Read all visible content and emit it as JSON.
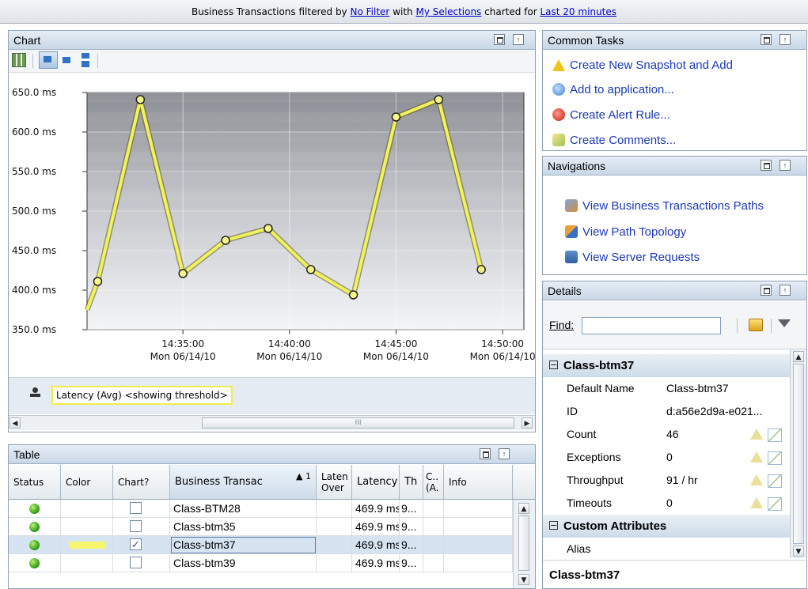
{
  "filter_bar": {
    "prefix": "Business Transactions filtered by",
    "filter_link": "No Filter",
    "with_text": "with",
    "selections_link": "My Selections",
    "charted_text": "charted for",
    "time_link": "Last 20 minutes"
  },
  "chart_panel": {
    "title": "Chart",
    "legend_label": "Latency (Avg) <showing threshold>"
  },
  "chart_data": {
    "type": "line",
    "title": "",
    "xlabel": "",
    "ylabel": "",
    "ylim": [
      350,
      650
    ],
    "y_ticks": [
      "650.0 ms",
      "600.0 ms",
      "550.0 ms",
      "500.0 ms",
      "450.0 ms",
      "400.0 ms",
      "350.0 ms"
    ],
    "y_tick_values": [
      650,
      600,
      550,
      500,
      450,
      400,
      350
    ],
    "x_ticks": [
      {
        "time": "14:35:00",
        "date": "Mon 06/14/10"
      },
      {
        "time": "14:40:00",
        "date": "Mon 06/14/10"
      },
      {
        "time": "14:45:00",
        "date": "Mon 06/14/10"
      },
      {
        "time": "14:50:00",
        "date": "Mon 06/14/10"
      }
    ],
    "series": [
      {
        "name": "Latency (Avg) <showing threshold>",
        "color": "#f2f25a",
        "x_minutes": [
          "14:30:30",
          "14:31",
          "14:33",
          "14:35",
          "14:37",
          "14:39",
          "14:41",
          "14:43",
          "14:45",
          "14:47",
          "14:49"
        ],
        "values": [
          375,
          411,
          641,
          421,
          463,
          478,
          426,
          394,
          619,
          641,
          426
        ]
      }
    ],
    "x_range": [
      "14:30:30",
      "14:51"
    ],
    "grid": true
  },
  "common_tasks": {
    "title": "Common Tasks",
    "items": [
      {
        "label": "Create New Snapshot and Add",
        "icon": "warning-icon"
      },
      {
        "label": "Add to application...",
        "icon": "add-application-icon"
      },
      {
        "label": "Create Alert Rule...",
        "icon": "alert-rule-icon"
      },
      {
        "label": "Create Comments...",
        "icon": "comment-icon"
      }
    ]
  },
  "navigations": {
    "title": "Navigations",
    "items": [
      {
        "label": "View Business Transactions Paths",
        "icon": "paths-icon"
      },
      {
        "label": "View Path Topology",
        "icon": "topology-icon"
      },
      {
        "label": "View Server Requests",
        "icon": "server-requests-icon"
      }
    ]
  },
  "details": {
    "title": "Details",
    "find_label": "Find:",
    "section1": "Class-btm37",
    "rows": [
      {
        "label": "Default Name",
        "value": "Class-btm37"
      },
      {
        "label": "ID",
        "value": "d:a56e2d9a-e021..."
      },
      {
        "label": "Count",
        "value": "46"
      },
      {
        "label": "Exceptions",
        "value": "0"
      },
      {
        "label": "Throughput",
        "value": "91 / hr"
      },
      {
        "label": "Timeouts",
        "value": "0"
      }
    ],
    "section2": "Custom Attributes",
    "alias_label": "Alias",
    "footer": "Class-btm37"
  },
  "table_panel": {
    "title": "Table",
    "columns": {
      "status": "Status",
      "color": "Color",
      "chart": "Chart?",
      "name": "Business Transac",
      "sort_indicator": "▲ 1",
      "latency_over_1": "Laten",
      "latency_over_2": "Over",
      "latency": "Latency",
      "th": "Th",
      "c1": "C..",
      "c2": "(A.",
      "info": "Info"
    },
    "rows": [
      {
        "name": "Class-BTM28",
        "latency": "469.9 ms",
        "th": "9...",
        "checked": false,
        "color": ""
      },
      {
        "name": "Class-btm35",
        "latency": "469.9 ms",
        "th": "9...",
        "checked": false,
        "color": ""
      },
      {
        "name": "Class-btm37",
        "latency": "469.9 ms",
        "th": "9...",
        "checked": true,
        "color": "#f6f66c"
      },
      {
        "name": "Class-btm39",
        "latency": "469.9 ms",
        "th": "9...",
        "checked": false,
        "color": ""
      }
    ]
  }
}
